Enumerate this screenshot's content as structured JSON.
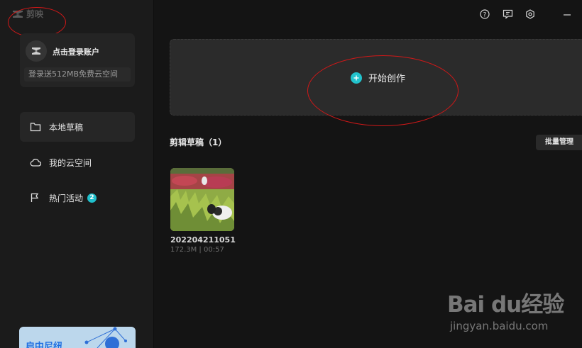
{
  "app": {
    "title": "剪映"
  },
  "account": {
    "login_label": "点击登录账户",
    "promo": "登录送512MB免费云空间"
  },
  "sidebar": {
    "items": [
      {
        "label": "本地草稿",
        "icon": "folder-icon",
        "active": true
      },
      {
        "label": "我的云空间",
        "icon": "cloud-icon",
        "active": false
      },
      {
        "label": "热门活动",
        "icon": "flag-icon",
        "badge": "2",
        "active": false
      }
    ],
    "banner_text": "启中尼纽"
  },
  "topbar": {
    "icons": [
      "help-icon",
      "feedback-icon",
      "settings-icon",
      "minimize-icon"
    ]
  },
  "main": {
    "create_label": "开始创作",
    "drafts_title": "剪辑草稿（1）",
    "batch_label": "批量管理",
    "drafts": [
      {
        "name": "202204211051",
        "meta": "172.3M | 00:57"
      }
    ]
  },
  "watermark": {
    "main": "Bai du经验",
    "sub": "jingyan.baidu.com"
  },
  "colors": {
    "accent": "#22c3cc",
    "annotation": "#d01818",
    "background": "#141414"
  }
}
